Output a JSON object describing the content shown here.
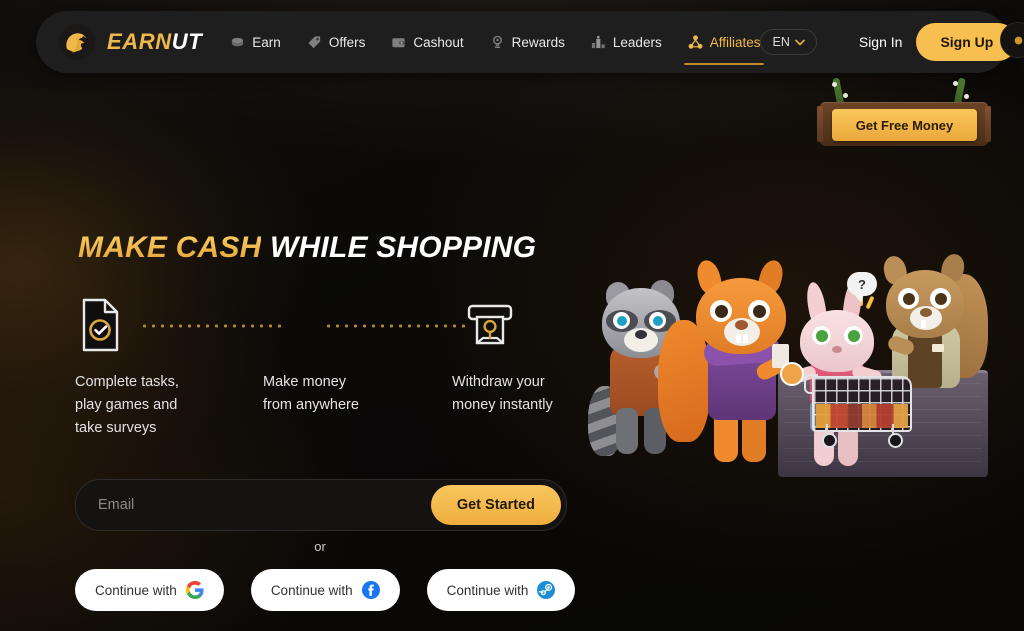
{
  "brand": {
    "name_gold": "EARN",
    "name_white": "UT",
    "logo_icon": "squirrel-logo-icon"
  },
  "nav": {
    "items": [
      {
        "label": "Earn",
        "icon": "coin-stack-icon",
        "active": false
      },
      {
        "label": "Offers",
        "icon": "price-tag-icon",
        "active": false
      },
      {
        "label": "Cashout",
        "icon": "wallet-icon",
        "active": false
      },
      {
        "label": "Rewards",
        "icon": "medal-icon",
        "active": false
      },
      {
        "label": "Leaders",
        "icon": "podium-icon",
        "active": false
      },
      {
        "label": "Affiliates",
        "icon": "network-share-icon",
        "active": true
      }
    ],
    "language": {
      "label": "EN",
      "chevron_icon": "chevron-down-icon"
    },
    "sign_in": "Sign In",
    "sign_up": "Sign Up",
    "edge_badge_icon": "coin-badge-icon"
  },
  "promo": {
    "label": "Get Free Money",
    "sign_icon": "wooden-sign-icon"
  },
  "hero": {
    "headline_gold": "MAKE CASH",
    "headline_white": "WHILE SHOPPING",
    "steps": [
      {
        "icon": "document-check-icon",
        "caption": "Complete tasks,\nplay games and\ntake surveys"
      },
      {
        "icon": "none",
        "caption": "Make money\nfrom anywhere"
      },
      {
        "icon": "atm-cash-icon",
        "caption": "Withdraw your\nmoney instantly"
      }
    ],
    "captions": {
      "one_l1": "Complete tasks,",
      "one_l2": "play games and",
      "one_l3": "take surveys",
      "two_l1": "Make money",
      "two_l2": "from anywhere",
      "three_l1": "Withdraw your",
      "three_l2": "money instantly"
    }
  },
  "signup_form": {
    "email_placeholder": "Email",
    "email_value": "",
    "cta": "Get Started",
    "divider": "or",
    "social_buttons": [
      {
        "label": "Continue with",
        "icon": "google-icon",
        "brand": "Google"
      },
      {
        "label": "Continue with",
        "icon": "facebook-icon",
        "brand": "Facebook"
      },
      {
        "label": "Continue with",
        "icon": "steam-icon",
        "brand": "Steam"
      }
    ]
  },
  "illustration": {
    "alt": "cartoon animal shoppers at a store counter",
    "characters": [
      "raccoon",
      "orange-squirrel",
      "pink-bunny",
      "brown-squirrel-cashier"
    ],
    "speech_bubble": "?",
    "props": [
      "shopping-cart",
      "store-counter",
      "shopping-basket"
    ]
  },
  "colors": {
    "accent_gold": "#f6bf4f",
    "accent_gold_dark": "#e5a332",
    "nav_bg": "#1e1e1e",
    "page_bg": "#0a0908",
    "text_primary": "#ffffff",
    "text_muted": "#8d8a86"
  }
}
